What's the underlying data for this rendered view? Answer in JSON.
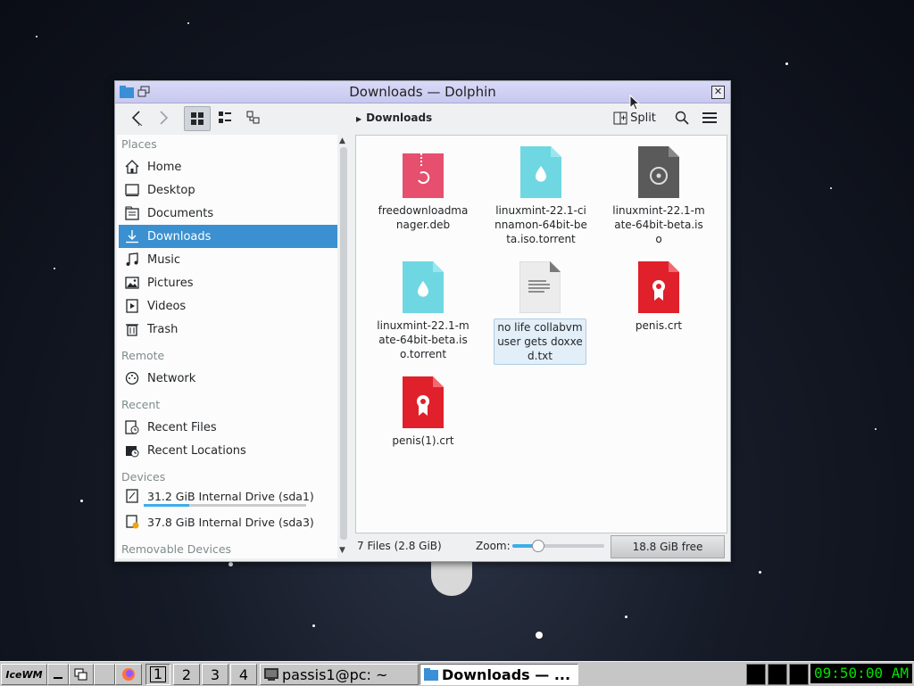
{
  "window": {
    "title": "Downloads — Dolphin"
  },
  "toolbar": {
    "breadcrumb": "Downloads",
    "split_label": "Split"
  },
  "sidebar": {
    "sections": [
      "Places",
      "Remote",
      "Recent",
      "Devices",
      "Removable Devices"
    ],
    "places": [
      {
        "label": "Home",
        "icon": "home-icon"
      },
      {
        "label": "Desktop",
        "icon": "desktop-icon"
      },
      {
        "label": "Documents",
        "icon": "documents-icon"
      },
      {
        "label": "Downloads",
        "icon": "download-icon",
        "selected": true
      },
      {
        "label": "Music",
        "icon": "music-icon"
      },
      {
        "label": "Pictures",
        "icon": "pictures-icon"
      },
      {
        "label": "Videos",
        "icon": "videos-icon"
      },
      {
        "label": "Trash",
        "icon": "trash-icon"
      }
    ],
    "remote": [
      {
        "label": "Network",
        "icon": "network-icon"
      }
    ],
    "recent": [
      {
        "label": "Recent Files",
        "icon": "recent-files-icon"
      },
      {
        "label": "Recent Locations",
        "icon": "recent-locations-icon"
      }
    ],
    "devices": [
      {
        "label": "31.2 GiB Internal Drive (sda1)",
        "icon": "drive-icon",
        "used_fraction": 0.28
      },
      {
        "label": "37.8 GiB Internal Drive (sda3)",
        "icon": "drive-warning-icon"
      }
    ]
  },
  "files": [
    {
      "name": "freedownloadmanager.deb",
      "icon": "deb-package-icon",
      "color": "#e64f6e"
    },
    {
      "name": "linuxmint-22.1-cinnamon-64bit-beta.iso.torrent",
      "icon": "torrent-icon",
      "color": "#6fd7e2"
    },
    {
      "name": "linuxmint-22.1-mate-64bit-beta.iso",
      "icon": "iso-disc-icon",
      "color": "#5a5a5a"
    },
    {
      "name": "linuxmint-22.1-mate-64bit-beta.iso.torrent",
      "icon": "torrent-icon",
      "color": "#6fd7e2"
    },
    {
      "name": "no life collabvm user gets doxxed.txt",
      "icon": "text-file-icon",
      "color": "#e7e7e7",
      "selected": true
    },
    {
      "name": "penis.crt",
      "icon": "certificate-icon",
      "color": "#e0202a"
    },
    {
      "name": "penis(1).crt",
      "icon": "certificate-icon",
      "color": "#e0202a"
    }
  ],
  "status": {
    "count": "7 Files (2.8 GiB)",
    "zoom_label": "Zoom:",
    "zoom_fraction": 0.27,
    "free": "18.8 GiB free"
  },
  "taskbar": {
    "start_label": "IceWM",
    "workspaces": [
      "1",
      "2",
      "3",
      "4"
    ],
    "tasks": [
      {
        "label": "passis1@pc: ~",
        "icon": "terminal-icon"
      },
      {
        "label": "Downloads — ...",
        "icon": "folder-icon",
        "active": true
      }
    ],
    "clock": "09:50:00 AM"
  },
  "colors": {
    "accent": "#3a90d0",
    "titlebar": "#c7c8ef",
    "clock_text": "#00e000"
  }
}
